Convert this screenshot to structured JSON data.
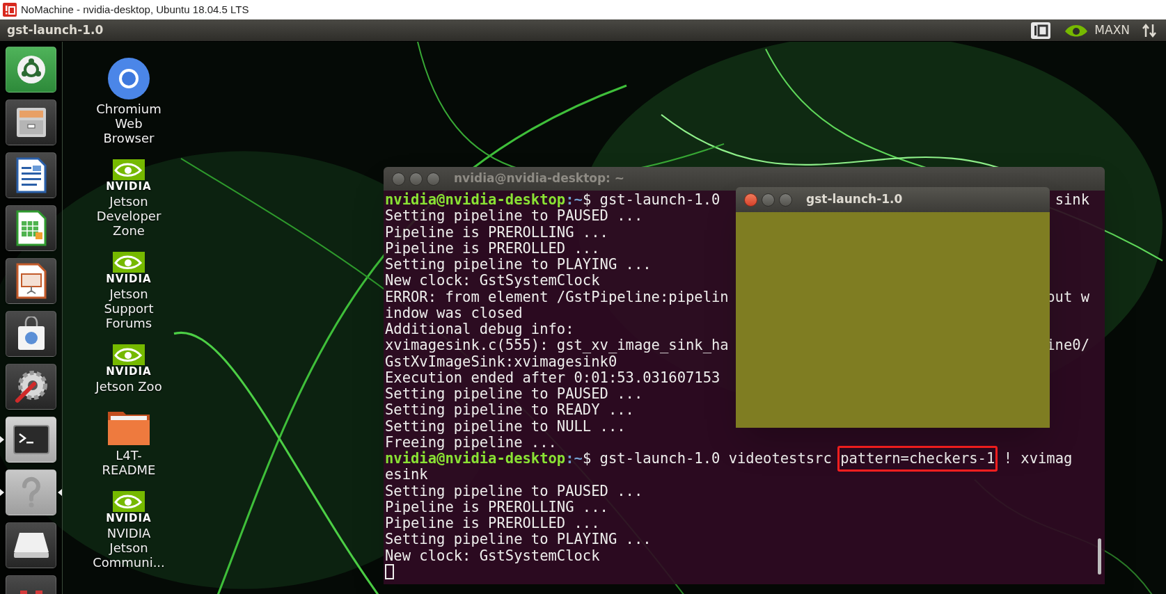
{
  "app_window": {
    "title": "NoMachine - nvidia-desktop, Ubuntu 18.04.5 LTS"
  },
  "top_panel": {
    "app_name": "gst-launch-1.0",
    "power_mode": "MAXN"
  },
  "launcher": [
    {
      "kind": "dash",
      "running": false,
      "focused": false
    },
    {
      "kind": "files",
      "running": false,
      "focused": false
    },
    {
      "kind": "writer",
      "running": false,
      "focused": false
    },
    {
      "kind": "calc",
      "running": false,
      "focused": false
    },
    {
      "kind": "impress",
      "running": false,
      "focused": false
    },
    {
      "kind": "software",
      "running": false,
      "focused": false
    },
    {
      "kind": "settings",
      "running": false,
      "focused": false
    },
    {
      "kind": "terminal",
      "running": true,
      "focused": false
    },
    {
      "kind": "help",
      "running": true,
      "focused": true
    },
    {
      "kind": "drive",
      "running": false,
      "focused": false
    },
    {
      "kind": "app",
      "running": false,
      "focused": false
    }
  ],
  "desktop_icons": [
    {
      "kind": "chromium",
      "label": [
        "Chromium",
        "Web",
        "Browser"
      ]
    },
    {
      "kind": "nvidia",
      "brand": "NVIDIA",
      "label": [
        "Jetson",
        "Developer",
        "Zone"
      ]
    },
    {
      "kind": "nvidia",
      "brand": "NVIDIA",
      "label": [
        "Jetson",
        "Support",
        "Forums"
      ]
    },
    {
      "kind": "nvidia",
      "brand": "NVIDIA",
      "label": [
        "Jetson Zoo"
      ]
    },
    {
      "kind": "folder",
      "label": [
        "L4T-",
        "README"
      ]
    },
    {
      "kind": "nvidia",
      "brand": "NVIDIA",
      "label": [
        "NVIDIA",
        "Jetson",
        "Communi..."
      ]
    }
  ],
  "terminal": {
    "title": "nvidia@nvidia-desktop: ~",
    "lines": [
      {
        "kind": "prompt",
        "user_host": "nvidia@nvidia-desktop",
        "path": ":~",
        "command": "$ gst-launch-1.0",
        "right": "sink"
      },
      {
        "kind": "output",
        "text": "Setting pipeline to PAUSED ..."
      },
      {
        "kind": "output",
        "text": "Pipeline is PREROLLING ..."
      },
      {
        "kind": "output",
        "text": "Pipeline is PREROLLED ..."
      },
      {
        "kind": "output",
        "text": "Setting pipeline to PLAYING ..."
      },
      {
        "kind": "output",
        "text": "New clock: GstSystemClock"
      },
      {
        "kind": "output",
        "text": "ERROR: from element /GstPipeline:pipelin",
        "right": "out w"
      },
      {
        "kind": "output",
        "text": "indow was closed"
      },
      {
        "kind": "output",
        "text": "Additional debug info:"
      },
      {
        "kind": "output",
        "text": "xvimagesink.c(555): gst_xv_image_sink_ha",
        "right": "ine0/"
      },
      {
        "kind": "output",
        "text": "GstXvImageSink:xvimagesink0"
      },
      {
        "kind": "output",
        "text": "Execution ended after 0:01:53.031607153"
      },
      {
        "kind": "output",
        "text": "Setting pipeline to PAUSED ..."
      },
      {
        "kind": "output",
        "text": "Setting pipeline to READY ..."
      },
      {
        "kind": "output",
        "text": "Setting pipeline to NULL ..."
      },
      {
        "kind": "output",
        "text": "Freeing pipeline ..."
      },
      {
        "kind": "prompt",
        "user_host": "nvidia@nvidia-desktop",
        "path": ":~",
        "command": "$ gst-launch-1.0 videotestsrc",
        "highlight": "pattern=checkers-1",
        "after": "! xvimag"
      },
      {
        "kind": "output",
        "text": "esink"
      },
      {
        "kind": "output",
        "text": "Setting pipeline to PAUSED ..."
      },
      {
        "kind": "output",
        "text": "Pipeline is PREROLLING ..."
      },
      {
        "kind": "output",
        "text": "Pipeline is PREROLLED ..."
      },
      {
        "kind": "output",
        "text": "Setting pipeline to PLAYING ..."
      },
      {
        "kind": "output",
        "text": "New clock: GstSystemClock"
      },
      {
        "kind": "cursor"
      }
    ]
  },
  "video_window": {
    "title": "gst-launch-1.0"
  }
}
